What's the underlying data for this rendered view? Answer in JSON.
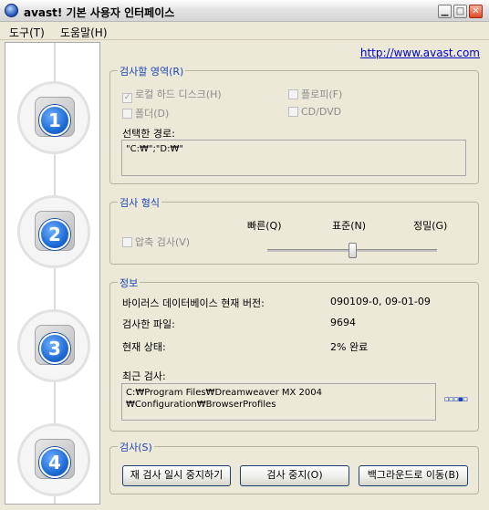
{
  "window": {
    "title": "avast! 기본 사용자 인터페이스"
  },
  "menu": [
    {
      "label": "도구(T)"
    },
    {
      "label": "도움말(H)"
    }
  ],
  "link": "http://www.avast.com",
  "steps": [
    "1",
    "2",
    "3",
    "4"
  ],
  "scan_area": {
    "title": "검사할 영역(R)",
    "local_disks": {
      "label": "로컬 하드 디스크(H)",
      "checked": true,
      "check": "✓"
    },
    "floppy": {
      "label": "플로피(F)",
      "checked": false
    },
    "folder": {
      "label": "폴더(D)",
      "checked": false
    },
    "cd_dvd": {
      "label": "CD/DVD",
      "checked": false
    },
    "path_label": "선택한 경로:",
    "path_value": "\"C:₩\";\"D:₩\""
  },
  "scan_type": {
    "title": "검사 형식",
    "archive": {
      "label": "압축 검사(V)",
      "checked": false
    },
    "levels": [
      "빠른(Q)",
      "표준(N)",
      "정밀(G)"
    ],
    "level_index": 1
  },
  "info": {
    "title": "정보",
    "rows": [
      {
        "label": "바이러스 데이터베이스 현재 버전:",
        "value": "090109-0, 09-01-09"
      },
      {
        "label": "검사한 파일:",
        "value": "9694"
      },
      {
        "label": "현재 상태:",
        "value": "2% 완료"
      }
    ],
    "recent_label": "최근 검사:",
    "recent_line1": "C:₩Program Files₩Dreamweaver MX 2004",
    "recent_line2": "₩Configuration₩BrowserProfiles",
    "dots": "▫▫▫▪▫"
  },
  "scan": {
    "title": "검사(S)",
    "pause_label": "재 검사 일시 중지하기",
    "stop_label": "검사 중지(O)",
    "background_label": "백그라운드로 이동(B)"
  },
  "colors": {
    "group_title": "#1c44b8",
    "link": "#0000cc",
    "step_blue": "#1f6cd6"
  }
}
